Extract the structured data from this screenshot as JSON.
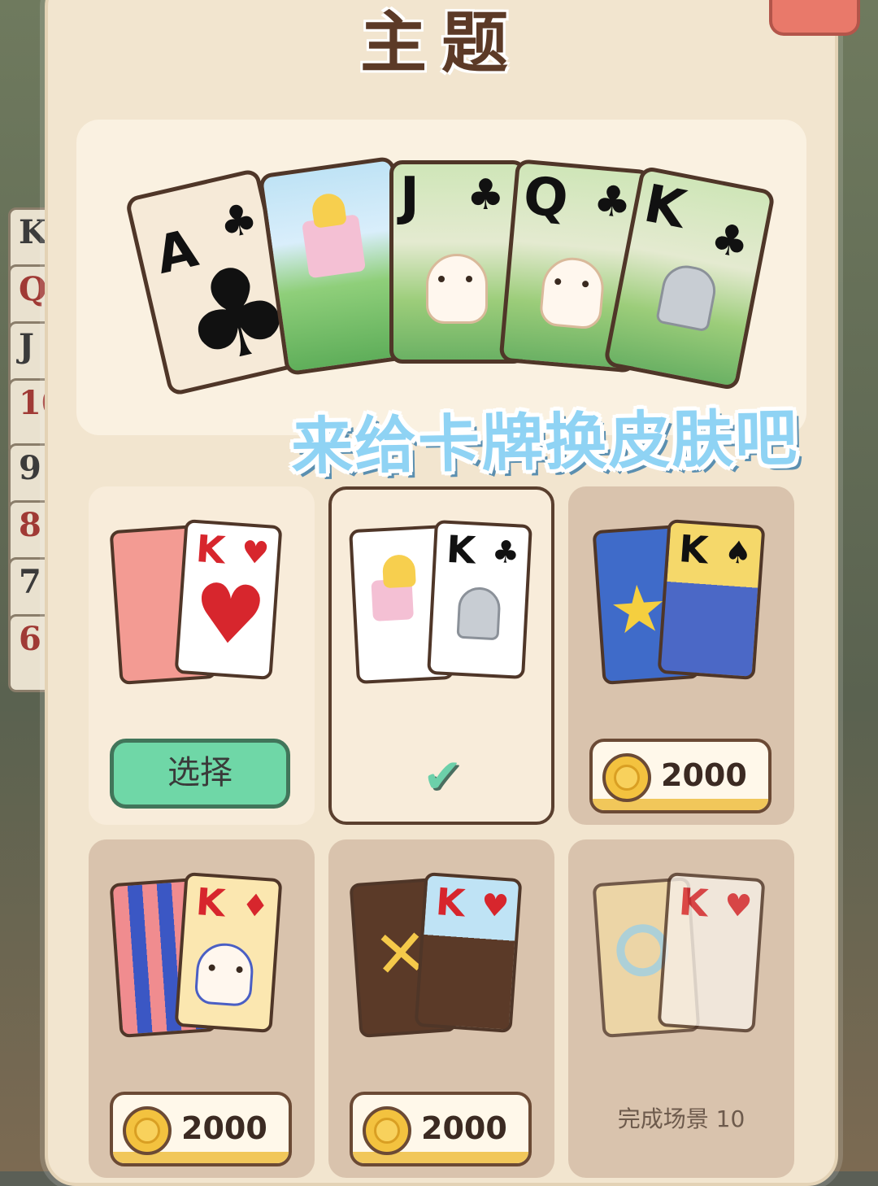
{
  "modal": {
    "title": "主题"
  },
  "preview": {
    "cards": [
      {
        "rank": "A",
        "suit": "♣",
        "center_suit": "♣"
      },
      {
        "rank": "",
        "suit": ""
      },
      {
        "rank": "J",
        "suit": "♣"
      },
      {
        "rank": "Q",
        "suit": "♣"
      },
      {
        "rank": "K",
        "suit": "♣"
      }
    ]
  },
  "banner": {
    "text": "来给卡牌换皮肤吧"
  },
  "themes": [
    {
      "rank": "K",
      "suit": "♥",
      "action": "选择",
      "state": "owned"
    },
    {
      "rank": "K",
      "suit": "♣",
      "state": "selected",
      "check_icon": "check-icon"
    },
    {
      "rank": "K",
      "suit": "♠",
      "price": "2000",
      "state": "locked-purchase"
    },
    {
      "rank": "K",
      "suit": "♦",
      "price": "2000",
      "state": "locked-purchase"
    },
    {
      "rank": "K",
      "suit": "♥",
      "price": "2000",
      "state": "locked-purchase"
    },
    {
      "rank": "K",
      "suit": "♥",
      "requirement": "完成场景 10",
      "state": "locked-level"
    }
  ],
  "colors": {
    "modal_bg": "#f2e5cf",
    "select_button": "#6fd7a7",
    "coin": "#f3c23f",
    "banner": "#8fd3f4",
    "close_button": "#e9796a"
  }
}
